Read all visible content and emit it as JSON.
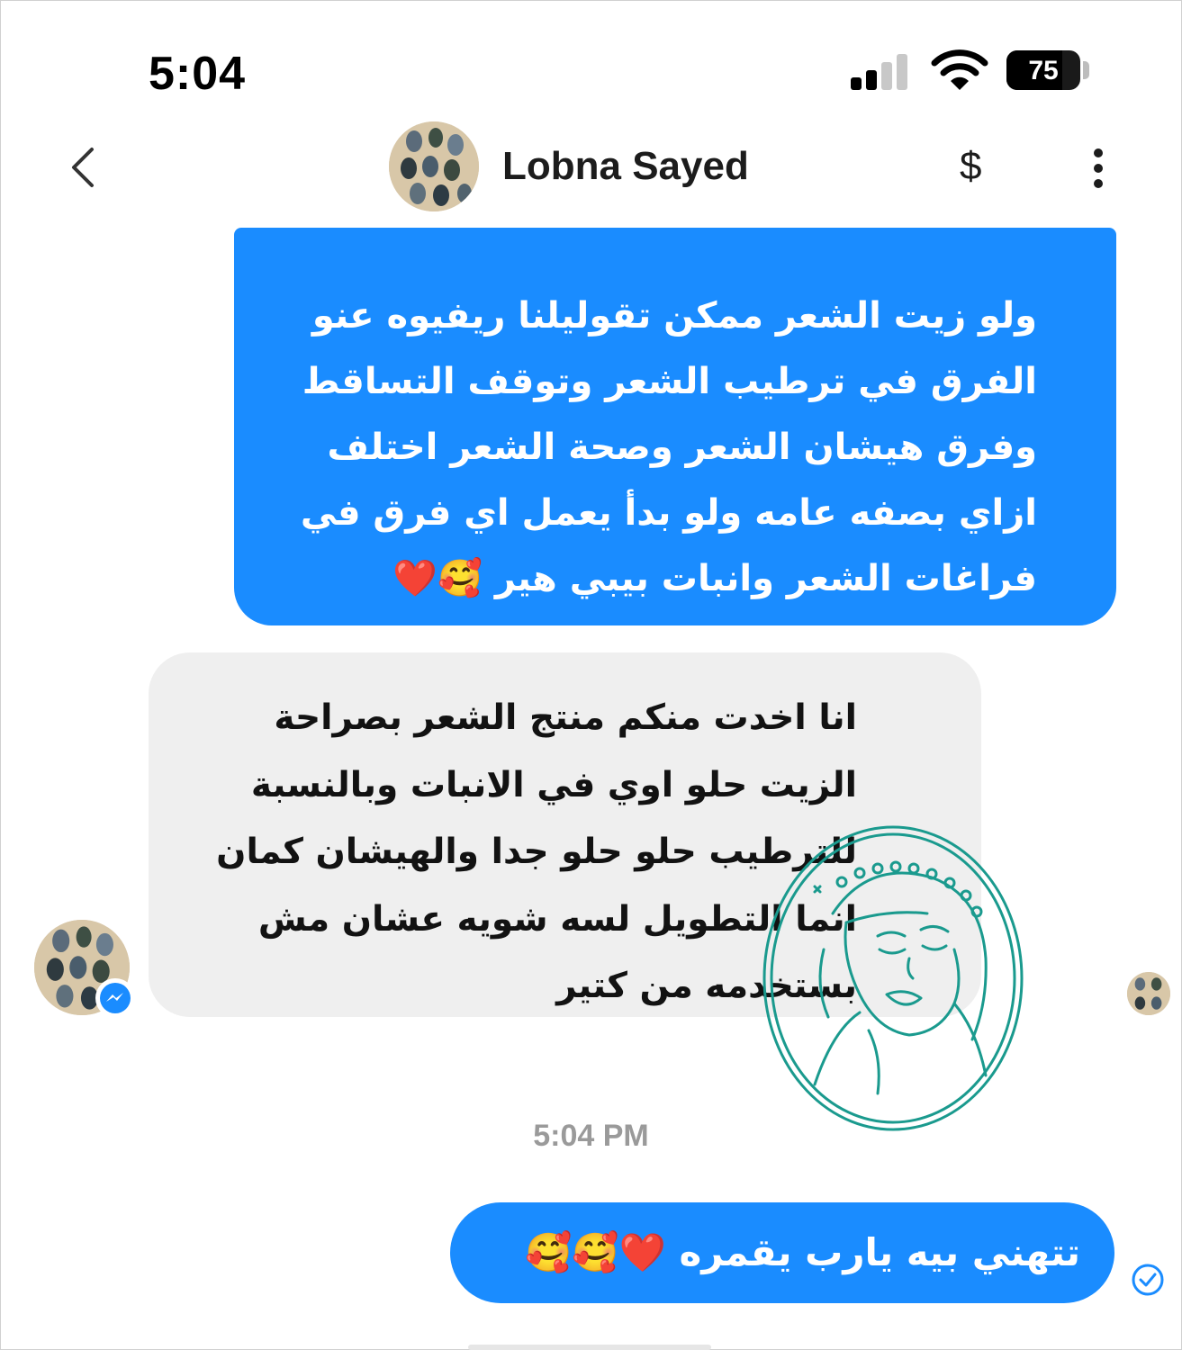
{
  "status_bar": {
    "time": "5:04",
    "battery": "75",
    "battery_level": 0.75
  },
  "header": {
    "contact_name": "Lobna Sayed",
    "payment_symbol": "$"
  },
  "messages": {
    "outgoing_1": "ولو زيت الشعر ممكن تقوليلنا ريفيوه عنو الفرق في ترطيب الشعر وتوقف التساقط وفرق هيشان الشعر وصحة الشعر اختلف ازاي بصفه عامه ولو بدأ يعمل اي فرق في فراغات الشعر وانبات بيبي هير 🥰❤️",
    "incoming_1": "انا اخدت منكم منتج الشعر بصراحة الزيت حلو اوي في الانبات وبالنسبة للترطيب حلو حلو جدا والهيشان كمان انما التطويل لسه شويه عشان مش بستخدمه من كتير",
    "timestamp": "5:04 PM",
    "outgoing_2": "تتهني بيه يارب يقمره ❤️🥰🥰"
  },
  "colors": {
    "outgoing_bubble": "#1a8cff",
    "incoming_bubble": "#efefef",
    "timestamp": "#9a9a9a",
    "watermark": "#1a9a8e",
    "messenger_badge": "#1a8cff"
  },
  "icons": {
    "back": "chevron-left-icon",
    "payment": "dollar-icon",
    "more": "more-vertical-icon",
    "signal": "signal-icon",
    "wifi": "wifi-icon",
    "battery": "battery-icon",
    "messenger": "messenger-icon",
    "sent": "check-circle-icon",
    "watermark": "brand-logo-stamp"
  }
}
